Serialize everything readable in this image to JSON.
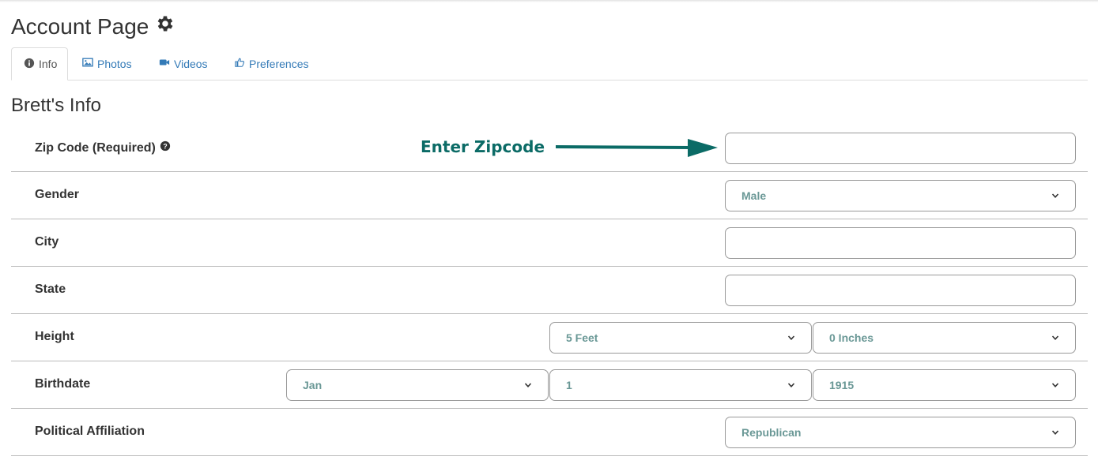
{
  "page": {
    "title": "Account Page"
  },
  "tabs": [
    {
      "label": "Info",
      "icon": "info-circle-icon",
      "active": true
    },
    {
      "label": "Photos",
      "icon": "picture-icon",
      "active": false
    },
    {
      "label": "Videos",
      "icon": "video-camera-icon",
      "active": false
    },
    {
      "label": "Preferences",
      "icon": "thumbs-up-icon",
      "active": false
    }
  ],
  "section": {
    "title": "Brett's Info"
  },
  "form": {
    "zip": {
      "label": "Zip Code (Required)",
      "value": ""
    },
    "annotation": "Enter Zipcode",
    "gender": {
      "label": "Gender",
      "value": "Male"
    },
    "city": {
      "label": "City",
      "value": ""
    },
    "state": {
      "label": "State",
      "value": ""
    },
    "height": {
      "label": "Height",
      "feet": "5 Feet",
      "inches": "0 Inches"
    },
    "birthdate": {
      "label": "Birthdate",
      "month": "Jan",
      "day": "1",
      "year": "1915"
    },
    "political": {
      "label": "Political Affiliation",
      "value": "Republican"
    }
  },
  "colors": {
    "accent": "#337ab7",
    "annotation": "#0b6b66",
    "select_text": "#6a9896"
  }
}
